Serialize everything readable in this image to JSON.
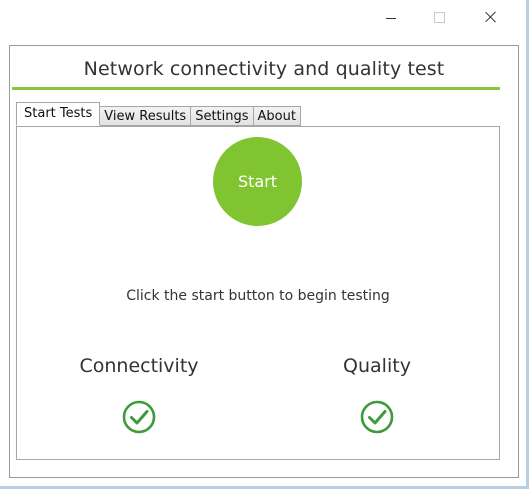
{
  "window": {
    "controls": [
      "minimize",
      "maximize",
      "close"
    ]
  },
  "app": {
    "title": "Network connectivity and quality test",
    "accent_color": "#80c431",
    "tabs": [
      {
        "label": "Start Tests",
        "active": true
      },
      {
        "label": "View Results",
        "active": false
      },
      {
        "label": "Settings",
        "active": false
      },
      {
        "label": "About",
        "active": false
      }
    ],
    "start_label": "Start",
    "instruction": "Click the start button to begin testing",
    "metrics": [
      {
        "label": "Connectivity",
        "status_icon": "check-circle-icon",
        "status_color": "#3d9a3d"
      },
      {
        "label": "Quality",
        "status_icon": "check-circle-icon",
        "status_color": "#3d9a3d"
      }
    ]
  }
}
